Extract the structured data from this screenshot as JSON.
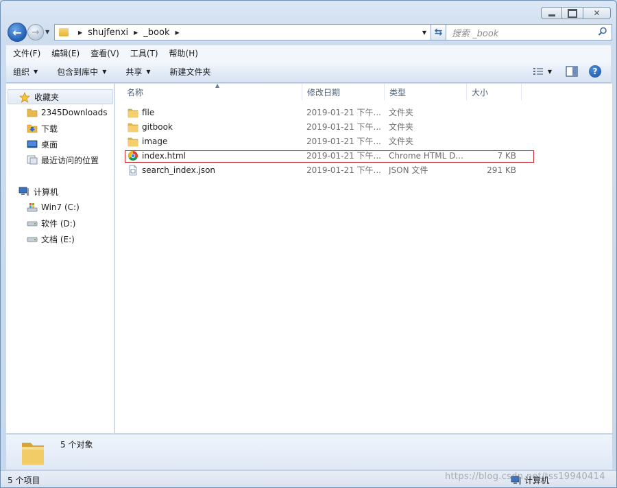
{
  "window": {
    "caption_buttons": [
      "minimize",
      "maximize",
      "close"
    ]
  },
  "address_bar": {
    "segments": [
      "shujfenxi",
      "_book"
    ],
    "search_placeholder": "搜索 _book"
  },
  "menu": [
    "文件(F)",
    "编辑(E)",
    "查看(V)",
    "工具(T)",
    "帮助(H)"
  ],
  "commands": {
    "organize": "组织",
    "include_library": "包含到库中",
    "share": "共享",
    "new_folder": "新建文件夹"
  },
  "navpane": {
    "favorites": {
      "label": "收藏夹",
      "items": [
        "2345Downloads",
        "下载",
        "桌面",
        "最近访问的位置"
      ]
    },
    "computer": {
      "label": "计算机",
      "items": [
        "Win7 (C:)",
        "软件 (D:)",
        "文档 (E:)"
      ]
    }
  },
  "columns": [
    "名称",
    "修改日期",
    "类型",
    "大小"
  ],
  "files": [
    {
      "name": "file",
      "date": "2019-01-21 下午...",
      "type": "文件夹",
      "size": "",
      "icon": "folder-icon"
    },
    {
      "name": "gitbook",
      "date": "2019-01-21 下午...",
      "type": "文件夹",
      "size": "",
      "icon": "folder-icon"
    },
    {
      "name": "image",
      "date": "2019-01-21 下午...",
      "type": "文件夹",
      "size": "",
      "icon": "folder-icon"
    },
    {
      "name": "index.html",
      "date": "2019-01-21 下午...",
      "type": "Chrome HTML D...",
      "size": "7 KB",
      "icon": "chrome-icon"
    },
    {
      "name": "search_index.json",
      "date": "2019-01-21 下午...",
      "type": "JSON 文件",
      "size": "291 KB",
      "icon": "json-file-icon"
    }
  ],
  "details_pane": {
    "text": "5 个对象"
  },
  "status_bar": {
    "left": "5 个项目",
    "right": "计算机"
  },
  "watermark": "https://blog.csdn.net/tss19940414",
  "colors": {
    "highlight_border": "#c8272d",
    "folder": "#e8b84a"
  }
}
